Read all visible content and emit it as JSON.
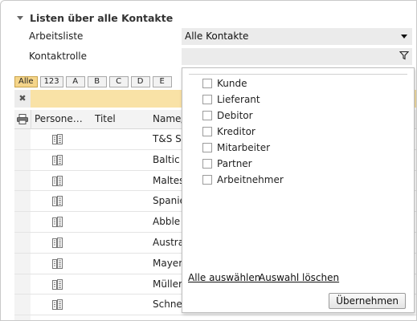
{
  "section": {
    "title": "Listen über alle Kontakte"
  },
  "fields": {
    "arbeitsliste_label": "Arbeitsliste",
    "arbeitsliste_value": "Alle Kontakte",
    "kontaktrolle_label": "Kontaktrolle",
    "kontaktrolle_value": ""
  },
  "letters": [
    "Alle",
    "123",
    "A",
    "B",
    "C",
    "D",
    "E"
  ],
  "filter_clear_icon": "✖",
  "grid": {
    "columns": [
      "Persone…",
      "Titel",
      "Name/"
    ],
    "rows": [
      "T&S S…",
      "Baltic L",
      "Maltes…",
      "Spanie",
      "Abble",
      "Austral",
      "Mayer",
      "Müller",
      "Schnei"
    ]
  },
  "popup": {
    "options": [
      "Kunde",
      "Lieferant",
      "Debitor",
      "Kreditor",
      "Mitarbeiter",
      "Partner",
      "Arbeitnehmer"
    ],
    "select_all": "Alle auswählen",
    "clear_selection": "Auswahl löschen",
    "apply": "Übernehmen"
  },
  "icons": {
    "printer": "printer-icon",
    "building": "building-icon",
    "filter": "filter-icon"
  },
  "colors": {
    "active_letter": "#f5d58a",
    "filter_bar": "#f9e2a6"
  }
}
